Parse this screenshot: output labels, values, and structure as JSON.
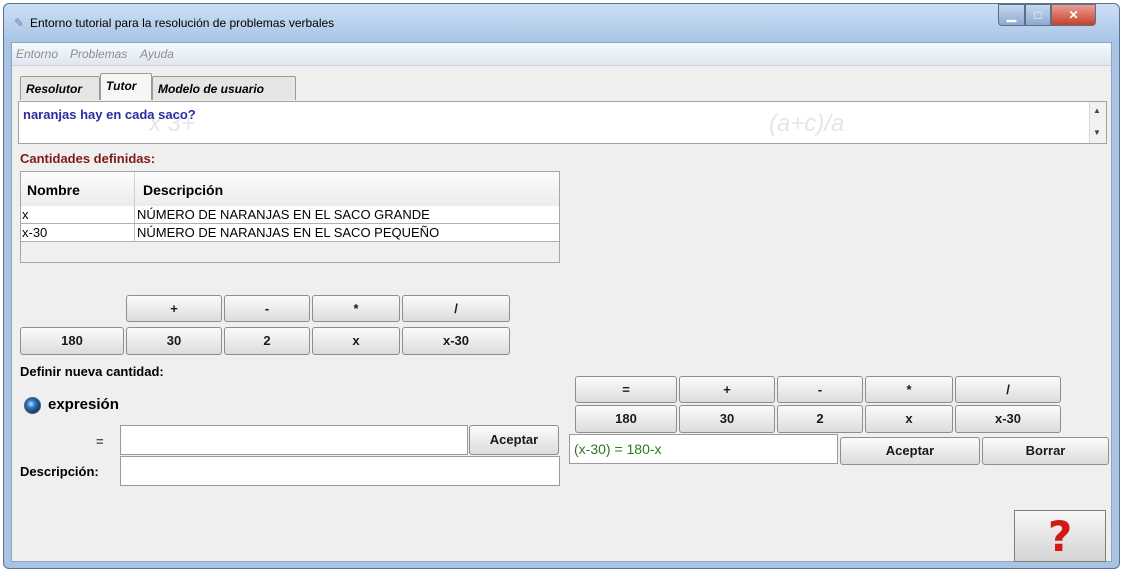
{
  "window": {
    "title": "Entorno tutorial para la resolución de problemas verbales"
  },
  "menu": [
    "Entorno",
    "Problemas",
    "Ayuda"
  ],
  "tabs": [
    "Resolutor",
    "Tutor",
    "Modelo de usuario"
  ],
  "problem": {
    "text": "naranjas hay en cada saco?"
  },
  "quantities": {
    "label": "Cantidades definidas:",
    "columns": [
      "Nombre",
      "Descripción"
    ],
    "rows": [
      {
        "name": "x",
        "description": "NÚMERO DE NARANJAS EN EL SACO GRANDE"
      },
      {
        "name": "x-30",
        "description": "NÚMERO DE NARANJAS EN EL SACO PEQUEÑO"
      }
    ]
  },
  "left_keypad": {
    "operators": [
      "+",
      "-",
      "*",
      "/"
    ],
    "values": [
      "180",
      "30",
      "2",
      "x",
      "x-30"
    ]
  },
  "define": {
    "label": "Definir nueva cantidad:",
    "radio_label": "expresión",
    "equals_label": "=",
    "accept_label": "Aceptar",
    "description_label": "Descripción:"
  },
  "right_keypad": {
    "operators": [
      "=",
      "+",
      "-",
      "*",
      "/"
    ],
    "values": [
      "180",
      "30",
      "2",
      "x",
      "x-30"
    ],
    "expression": "(x-30) = 180-x",
    "accept_label": "Aceptar",
    "clear_label": "Borrar"
  },
  "help": {
    "symbol": "?",
    "color": "#d11b12"
  }
}
